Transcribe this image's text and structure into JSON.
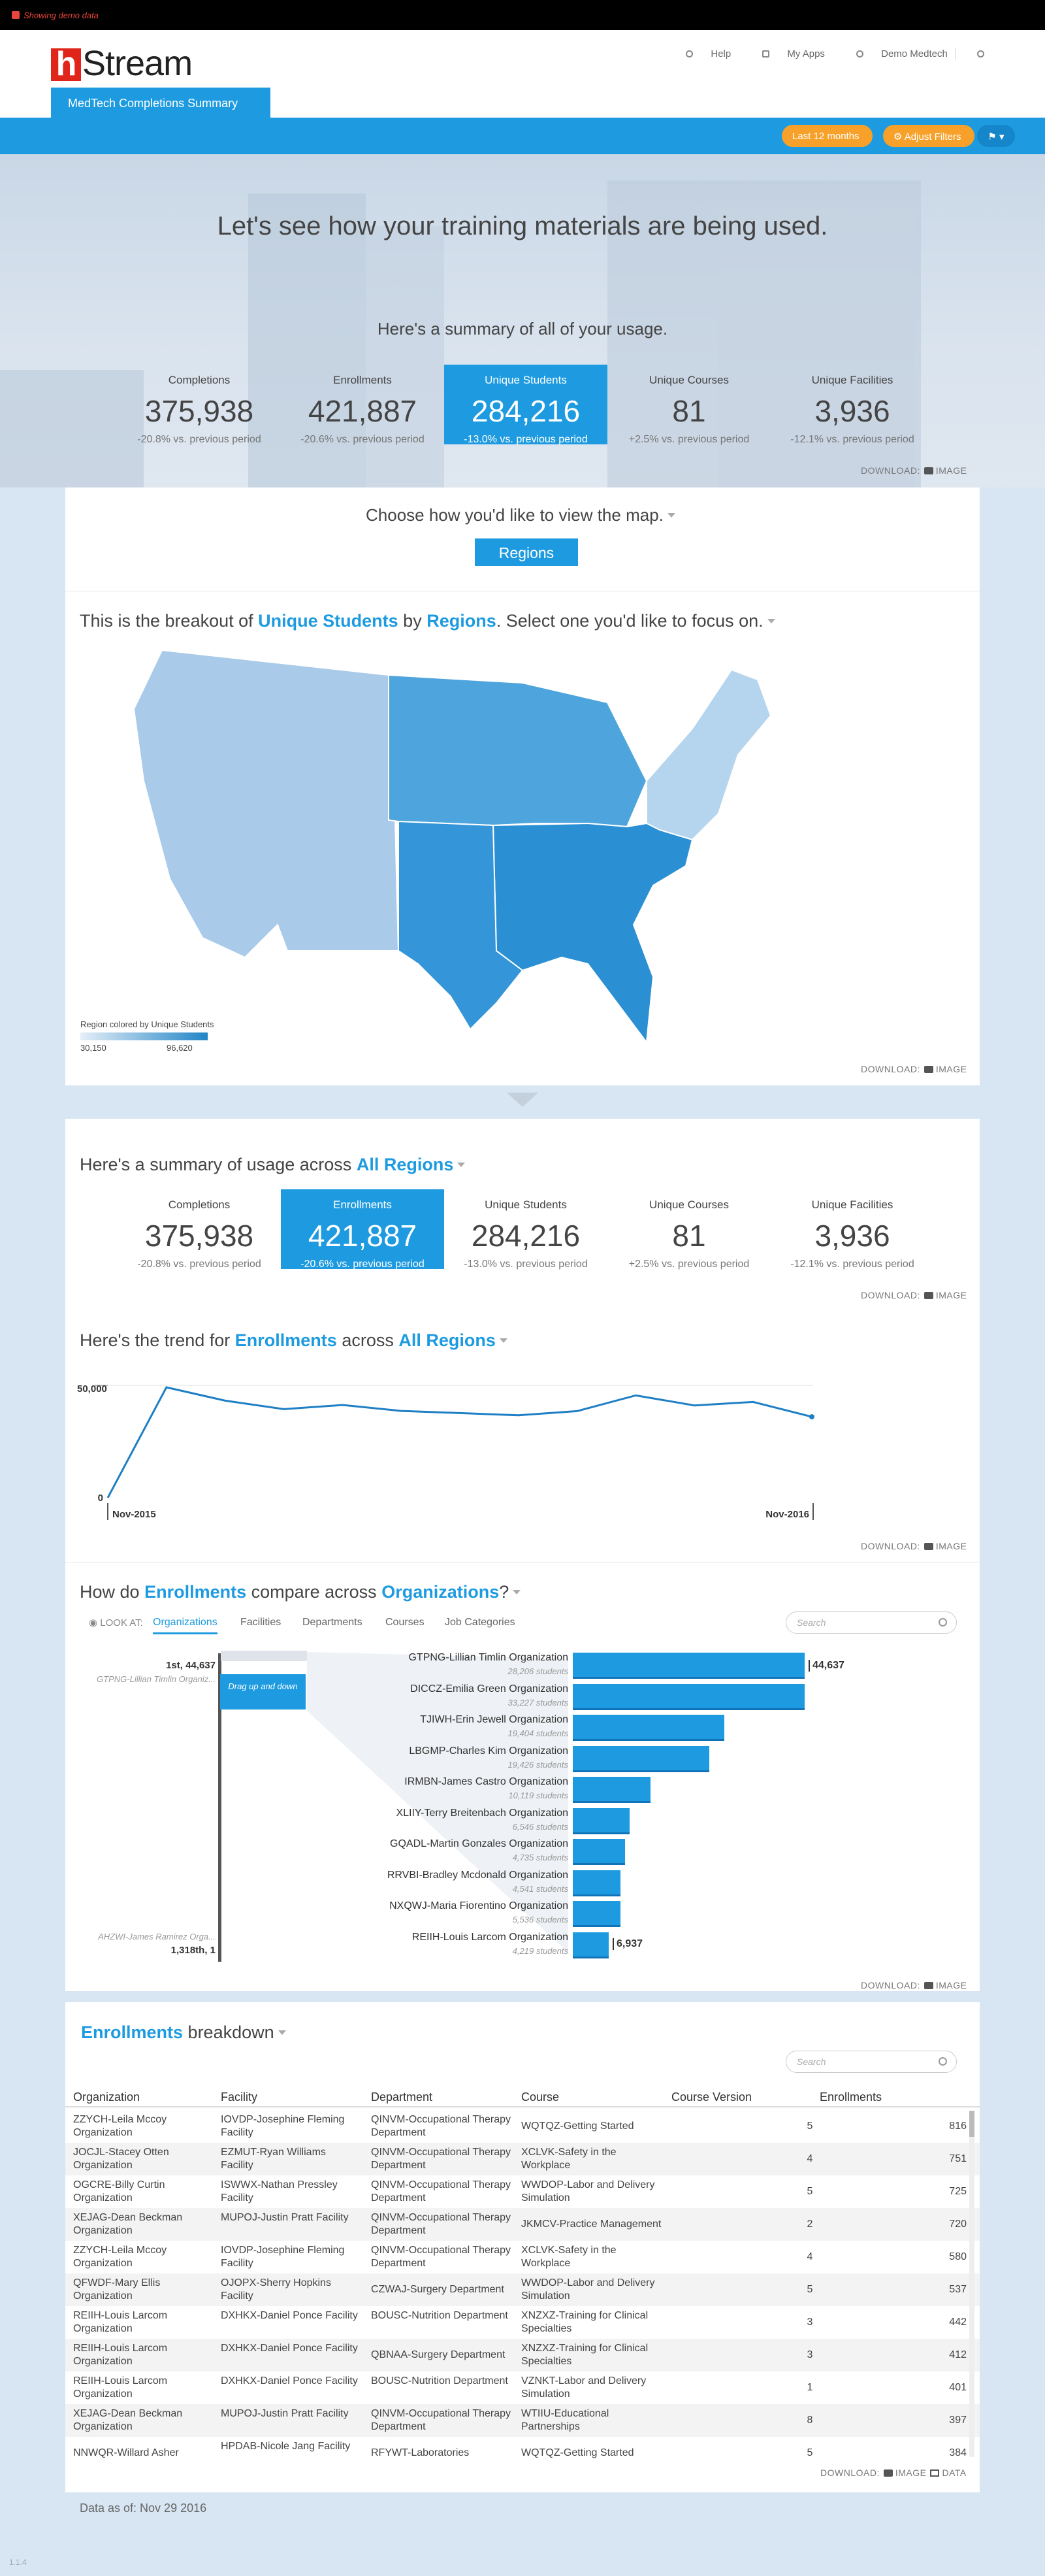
{
  "demo_banner": "Showing demo data",
  "header": {
    "logo_text": "Stream",
    "logo_mark": "h",
    "help": "Help",
    "my_apps": "My Apps",
    "user": "Demo Medtech",
    "active_tab": "MedTech Completions Summary"
  },
  "filters": {
    "range": "Last 12 months",
    "adjust": "Adjust Filters"
  },
  "hero": {
    "title": "Let's see how your training materials are being used.",
    "subtitle": "Here's a summary of all of your usage."
  },
  "summary": [
    {
      "label": "Completions",
      "value": "375,938",
      "change": "-20.8% vs. previous period"
    },
    {
      "label": "Enrollments",
      "value": "421,887",
      "change": "-20.6% vs. previous period"
    },
    {
      "label": "Unique Students",
      "value": "284,216",
      "change": "-13.0% vs. previous period"
    },
    {
      "label": "Unique Courses",
      "value": "81",
      "change": "+2.5% vs. previous period"
    },
    {
      "label": "Unique Facilities",
      "value": "3,936",
      "change": "-12.1% vs. previous period"
    }
  ],
  "download": {
    "label": "DOWNLOAD:",
    "image": "IMAGE",
    "data": "DATA"
  },
  "map_view": {
    "prompt": "Choose how you'd like to view the map.",
    "button": "Regions"
  },
  "breakout": {
    "pre": "This is the breakout of",
    "metric": "Unique Students",
    "by": "by",
    "dimension": "Regions",
    "post": ". Select one you'd like to focus on.",
    "legend_title": "Region colored by Unique Students",
    "legend_min": "30,150",
    "legend_max": "96,620"
  },
  "region_summary": {
    "pre": "Here's a summary of usage across",
    "target": "All Regions"
  },
  "trend": {
    "pre": "Here's the trend for",
    "metric": "Enrollments",
    "mid": "across",
    "target": "All Regions"
  },
  "compare": {
    "pre": "How do",
    "metric": "Enrollments",
    "mid": "compare across",
    "dimension": "Organizations",
    "q": "?",
    "look_at": "LOOK AT:",
    "tabs": [
      "Organizations",
      "Facilities",
      "Departments",
      "Courses",
      "Job Categories"
    ],
    "search_placeholder": "Search",
    "scroller_top_rank": "1st, 44,637",
    "scroller_top_name": "GTPNG-Lillian Timlin Organiz...",
    "scroller_bottom_rank": "1,318th, 1",
    "scroller_bottom_name": "AHZWI-James Ramirez Orga...",
    "drag_hint": "Drag up and down"
  },
  "breakdown": {
    "metric": "Enrollments",
    "title_rest": "breakdown",
    "search_placeholder": "Search",
    "columns": [
      "Organization",
      "Facility",
      "Department",
      "Course",
      "Course Version",
      "Enrollments"
    ],
    "rows": [
      [
        "ZZYCH-Leila Mccoy Organization",
        "IOVDP-Josephine Fleming Facility",
        "QINVM-Occupational Therapy Department",
        "WQTQZ-Getting Started",
        "5",
        "816"
      ],
      [
        "JOCJL-Stacey Otten Organization",
        "EZMUT-Ryan Williams Facility",
        "QINVM-Occupational Therapy Department",
        "XCLVK-Safety in the Workplace",
        "4",
        "751"
      ],
      [
        "OGCRE-Billy Curtin Organization",
        "ISWWX-Nathan Pressley Facility",
        "QINVM-Occupational Therapy Department",
        "WWDOP-Labor and Delivery Simulation",
        "5",
        "725"
      ],
      [
        "XEJAG-Dean Beckman Organization",
        "MUPOJ-Justin Pratt Facility",
        "QINVM-Occupational Therapy Department",
        "JKMCV-Practice Management",
        "2",
        "720"
      ],
      [
        "ZZYCH-Leila Mccoy Organization",
        "IOVDP-Josephine Fleming Facility",
        "QINVM-Occupational Therapy Department",
        "XCLVK-Safety in the Workplace",
        "4",
        "580"
      ],
      [
        "QFWDF-Mary Ellis Organization",
        "OJOPX-Sherry Hopkins Facility",
        "CZWAJ-Surgery Department",
        "WWDOP-Labor and Delivery Simulation",
        "5",
        "537"
      ],
      [
        "REIIH-Louis Larcom Organization",
        "DXHKX-Daniel Ponce Facility",
        "BOUSC-Nutrition Department",
        "XNZXZ-Training for Clinical Specialties",
        "3",
        "442"
      ],
      [
        "REIIH-Louis Larcom Organization",
        "DXHKX-Daniel Ponce Facility",
        "QBNAA-Surgery Department",
        "XNZXZ-Training for Clinical Specialties",
        "3",
        "412"
      ],
      [
        "REIIH-Louis Larcom Organization",
        "DXHKX-Daniel Ponce Facility",
        "BOUSC-Nutrition Department",
        "VZNKT-Labor and Delivery Simulation",
        "1",
        "401"
      ],
      [
        "XEJAG-Dean Beckman Organization",
        "MUPOJ-Justin Pratt Facility",
        "QINVM-Occupational Therapy Department",
        "WTIIU-Educational Partnerships",
        "8",
        "397"
      ],
      [
        "NNWQR-Willard Asher",
        "HPDAB-Nicole Jang Facility",
        "RFYWT-Laboratories",
        "WQTQZ-Getting Started",
        "5",
        "384"
      ]
    ]
  },
  "data_as_of": "Data as of: Nov 29 2016",
  "version": "1.1.4",
  "colors": {
    "accent": "#1e9be0",
    "brand_red": "#e0261b",
    "orange": "#f7a12b"
  },
  "chart_data": [
    {
      "type": "line",
      "title": "",
      "x": [
        "Nov-2015",
        "Dec-2015",
        "Jan-2016",
        "Feb-2016",
        "Mar-2016",
        "Apr-2016",
        "May-2016",
        "Jun-2016",
        "Jul-2016",
        "Aug-2016",
        "Sep-2016",
        "Oct-2016",
        "Nov-2016"
      ],
      "series": [
        {
          "values": [
            0,
            50600,
            44500,
            40600,
            42500,
            39800,
            38800,
            37800,
            39700,
            46900,
            42300,
            43900,
            37100
          ]
        }
      ],
      "ylim": [
        0,
        50000
      ],
      "ytick_labels": [
        "0",
        "50,000"
      ],
      "xtick_labels": [
        "Nov-2015",
        "Nov-2016"
      ],
      "grid": false
    },
    {
      "type": "bar",
      "orientation": "horizontal",
      "categories": [
        "GTPNG-Lillian Timlin Organization",
        "DICCZ-Emilia Green Organization",
        "TJIWH-Erin Jewell Organization",
        "LBGMP-Charles Kim Organization",
        "IRMBN-James Castro Organization",
        "XLIIY-Terry Breitenbach Organization",
        "GQADL-Martin Gonzales Organization",
        "RRVBI-Bradley Mcdonald Organization",
        "NXQWJ-Maria Fiorentino Organization",
        "REIIH-Louis Larcom Organization"
      ],
      "sublabels": [
        "28,206 students",
        "33,227 students",
        "19,404 students",
        "19,426 students",
        "10,119 students",
        "6,546 students",
        "4,735 students",
        "4,541 students",
        "5,536 students",
        "4,219 students"
      ],
      "values": [
        44637,
        44637,
        29200,
        26300,
        15000,
        11000,
        10000,
        9200,
        9200,
        6937
      ],
      "value_labels": {
        "first": "44,637",
        "last": "6,937"
      }
    }
  ]
}
